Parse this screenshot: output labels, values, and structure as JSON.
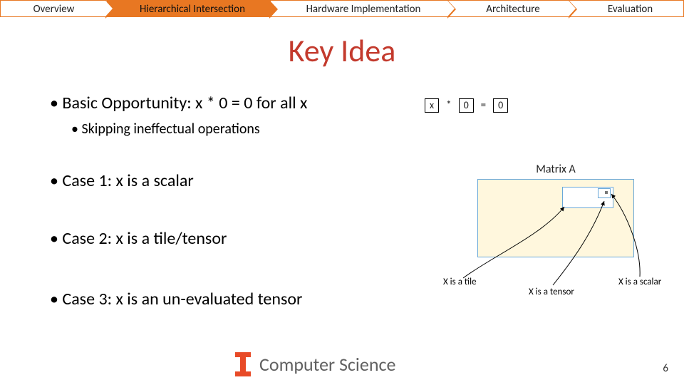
{
  "nav": {
    "items": [
      {
        "label": "Overview"
      },
      {
        "label": "Hierarchical Intersection"
      },
      {
        "label": "Hardware Implementation"
      },
      {
        "label": "Architecture"
      },
      {
        "label": "Evaluation"
      }
    ],
    "active_index": 1
  },
  "title": "Key Idea",
  "bullets": {
    "b1": "Basic Opportunity: x * 0 = 0 for all x",
    "b1_sub": "Skipping ineffectual operations",
    "b2": "Case 1: x is a scalar",
    "b3": "Case 2: x is a tile/tensor",
    "b4": "Case 3: x is an un-evaluated tensor"
  },
  "equation": {
    "lhs": "x",
    "op1": "*",
    "zero1": "0",
    "eq": "=",
    "zero2": "0"
  },
  "matrix": {
    "label": "Matrix A"
  },
  "annotations": {
    "tile": "X is a tile",
    "tensor": "X is a tensor",
    "scalar": "X is a scalar"
  },
  "footer": {
    "dept": "Computer Science",
    "page": "6"
  },
  "colors": {
    "accent": "#e87722",
    "title": "#c33a2d",
    "matrix_fill": "#fff7dd",
    "matrix_border": "#6aa8d8",
    "logo_orange": "#e84a27",
    "logo_navy": "#13294b"
  }
}
